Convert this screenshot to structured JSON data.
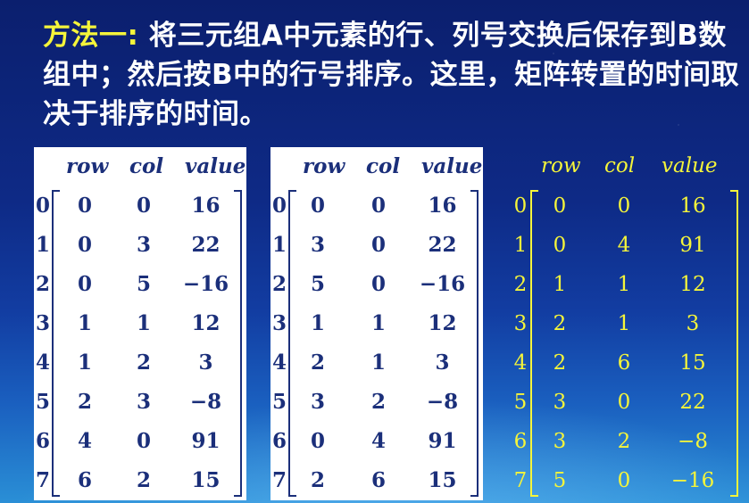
{
  "title": {
    "lead": "方法一:",
    "body": " 将三元组A中元素的行、列号交换后保存到B数组中；然后按B中的行号排序。这里，矩阵转置的时间取决于排序的时间。"
  },
  "tables": [
    {
      "headers": [
        "row",
        "col",
        "value"
      ],
      "rows": [
        {
          "idx": "0",
          "row": "0",
          "col": "0",
          "value": "16"
        },
        {
          "idx": "1",
          "row": "0",
          "col": "3",
          "value": "22"
        },
        {
          "idx": "2",
          "row": "0",
          "col": "5",
          "value": "−16"
        },
        {
          "idx": "3",
          "row": "1",
          "col": "1",
          "value": "12"
        },
        {
          "idx": "4",
          "row": "1",
          "col": "2",
          "value": "3"
        },
        {
          "idx": "5",
          "row": "2",
          "col": "3",
          "value": "−8"
        },
        {
          "idx": "6",
          "row": "4",
          "col": "0",
          "value": "91"
        },
        {
          "idx": "7",
          "row": "6",
          "col": "2",
          "value": "15"
        }
      ]
    },
    {
      "headers": [
        "row",
        "col",
        "value"
      ],
      "rows": [
        {
          "idx": "0",
          "row": "0",
          "col": "0",
          "value": "16"
        },
        {
          "idx": "1",
          "row": "3",
          "col": "0",
          "value": "22"
        },
        {
          "idx": "2",
          "row": "5",
          "col": "0",
          "value": "−16"
        },
        {
          "idx": "3",
          "row": "1",
          "col": "1",
          "value": "12"
        },
        {
          "idx": "4",
          "row": "2",
          "col": "1",
          "value": "3"
        },
        {
          "idx": "5",
          "row": "3",
          "col": "2",
          "value": "−8"
        },
        {
          "idx": "6",
          "row": "0",
          "col": "4",
          "value": "91"
        },
        {
          "idx": "7",
          "row": "2",
          "col": "6",
          "value": "15"
        }
      ]
    },
    {
      "headers": [
        "row",
        "col",
        "value"
      ],
      "rows": [
        {
          "idx": "0",
          "row": "0",
          "col": "0",
          "value": "16"
        },
        {
          "idx": "1",
          "row": "0",
          "col": "4",
          "value": "91"
        },
        {
          "idx": "2",
          "row": "1",
          "col": "1",
          "value": "12"
        },
        {
          "idx": "3",
          "row": "2",
          "col": "1",
          "value": "3"
        },
        {
          "idx": "4",
          "row": "2",
          "col": "6",
          "value": "15"
        },
        {
          "idx": "5",
          "row": "3",
          "col": "0",
          "value": "22"
        },
        {
          "idx": "6",
          "row": "3",
          "col": "2",
          "value": "−8"
        },
        {
          "idx": "7",
          "row": "5",
          "col": "0",
          "value": "−16"
        }
      ]
    }
  ]
}
